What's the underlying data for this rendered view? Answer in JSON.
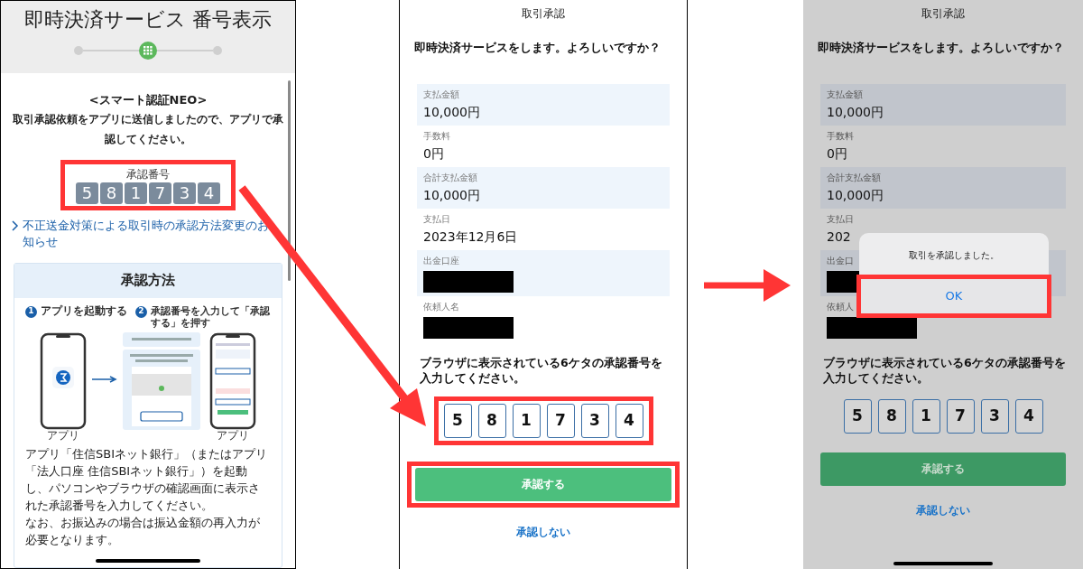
{
  "number_display_screen": {
    "title": "即時決済サービス 番号表示",
    "steps": [
      {
        "selected": false
      },
      {
        "selected": true
      },
      {
        "selected": false
      }
    ],
    "heading": "<スマート認証NEO>",
    "message": "取引承認依頼をアプリに送信しましたので、アプリで承認してください。",
    "code": {
      "label": "承認番号",
      "digits": [
        "5",
        "8",
        "1",
        "7",
        "3",
        "4"
      ],
      "highlighted": true
    },
    "notice_link": "不正送金対策による取引時の承認方法変更のお知らせ",
    "method_card": {
      "title": "承認方法",
      "steps": [
        {
          "number": "1",
          "label": "アプリを起動する"
        },
        {
          "number": "2",
          "label": "承認番号を入力して「承認する」を押す"
        }
      ],
      "captions": [
        "アプリ",
        "アプリ"
      ],
      "paragraphs": [
        "アプリ「住信SBIネット銀行」（またはアプリ「法人口座 住信SBIネット銀行」）を起動し、パソコンやブラウザの確認画面に表示された承認番号を入力してください。",
        "なお、お振込みの場合は振込金額の再入力が必要となります。"
      ]
    }
  },
  "approval_screen": {
    "dimmed": false,
    "title": "取引承認",
    "question": "即時決済サービスをします。よろしいですか？",
    "fields": [
      {
        "label": "支払金額",
        "value": "10,000円",
        "shaded": true,
        "redacted": false
      },
      {
        "label": "手数料",
        "value": "0円",
        "shaded": false,
        "redacted": false
      },
      {
        "label": "合計支払金額",
        "value": "10,000円",
        "shaded": true,
        "redacted": false
      },
      {
        "label": "支払日",
        "value": "2023年12月6日",
        "shaded": false,
        "redacted": false
      },
      {
        "label": "出金口座",
        "redacted": true,
        "shaded": true
      },
      {
        "label": "依頼人名",
        "redacted": true,
        "shaded": false
      }
    ],
    "instruction": "ブラウザに表示されている6ケタの承認番号を入力してください。",
    "code": {
      "digits": [
        "5",
        "8",
        "1",
        "7",
        "3",
        "4"
      ],
      "highlighted": true
    },
    "approve_button": {
      "label": "承認する",
      "highlighted": true
    },
    "decline_link": "承認しない"
  },
  "approved_screen": {
    "dimmed": true,
    "title": "取引承認",
    "question": "即時決済サービスをします。よろしいですか？",
    "fields": [
      {
        "label": "支払金額",
        "value": "10,000円",
        "shaded": true,
        "redacted": false
      },
      {
        "label": "手数料",
        "value": "0円",
        "shaded": false,
        "redacted": false
      },
      {
        "label": "合計支払金額",
        "value": "10,000円",
        "shaded": true,
        "redacted": false
      },
      {
        "label": "支払日",
        "value": "202",
        "shaded": false,
        "redacted": false
      },
      {
        "label": "出金口",
        "redacted": true,
        "shaded": true
      },
      {
        "label": "依頼人",
        "redacted": true,
        "shaded": false
      }
    ],
    "instruction": "ブラウザに表示されている6ケタの承認番号を入力してください。",
    "code": {
      "digits": [
        "5",
        "8",
        "1",
        "7",
        "3",
        "4"
      ],
      "highlighted": false
    },
    "approve_button": {
      "label": "承認する",
      "highlighted": false
    },
    "decline_link": "承認しない",
    "dialog": {
      "message": "取引を承認しました。",
      "ok_button": {
        "label": "OK",
        "highlighted": true
      }
    }
  }
}
